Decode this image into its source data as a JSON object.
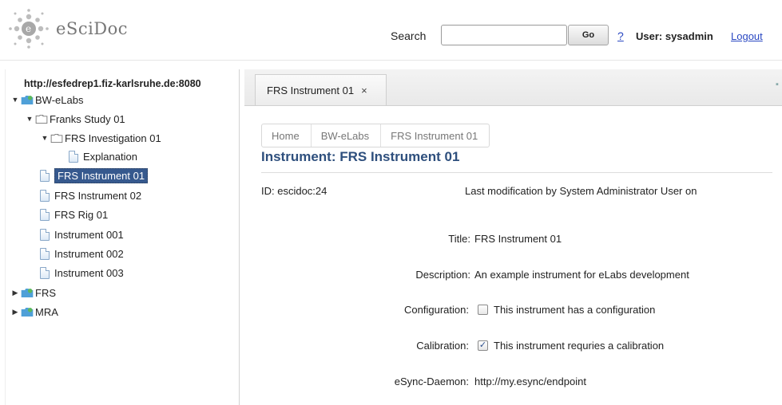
{
  "header": {
    "logo_text": "eSciDoc",
    "search_label": "Search",
    "search_value": "",
    "go_label": "Go",
    "help_label": "?",
    "user_label": "User: sysadmin",
    "logout_label": "Logout"
  },
  "tree": {
    "server": "http://esfedrep1.fiz-karlsruhe.de:8080",
    "items": [
      {
        "label": "BW-eLabs",
        "arrow": "▼",
        "icon": "context-folder-icon"
      },
      {
        "label": "Franks Study 01",
        "arrow": "▼",
        "icon": "folder-icon"
      },
      {
        "label": "FRS Investigation 01",
        "arrow": "▼",
        "icon": "folder-icon"
      },
      {
        "label": "Explanation",
        "arrow": "",
        "icon": "document-icon"
      },
      {
        "label": "FRS Instrument 01",
        "arrow": "",
        "icon": "document-icon"
      },
      {
        "label": "FRS Instrument 02",
        "arrow": "",
        "icon": "document-icon"
      },
      {
        "label": "FRS Rig 01",
        "arrow": "",
        "icon": "document-icon"
      },
      {
        "label": "Instrument 001",
        "arrow": "",
        "icon": "document-icon"
      },
      {
        "label": "Instrument 002",
        "arrow": "",
        "icon": "document-icon"
      },
      {
        "label": "Instrument 003",
        "arrow": "",
        "icon": "document-icon"
      },
      {
        "label": "FRS",
        "arrow": "▶",
        "icon": "context-folder-icon"
      },
      {
        "label": "MRA",
        "arrow": "▶",
        "icon": "context-folder-icon"
      }
    ],
    "selected": "FRS Instrument 01"
  },
  "tab": {
    "label": "FRS Instrument 01",
    "close": "×"
  },
  "breadcrumb": [
    "Home",
    "BW-eLabs",
    "FRS Instrument 01"
  ],
  "detail": {
    "title": "Instrument: FRS Instrument 01",
    "id": "ID: escidoc:24",
    "modified": "Last modification by System Administrator User on",
    "fields": {
      "title_label": "Title:",
      "title_value": "FRS Instrument 01",
      "description_label": "Description:",
      "description_value": "An example instrument for eLabs development",
      "configuration_label": "Configuration:",
      "configuration_value": "This instrument has a configuration",
      "configuration_checked": false,
      "calibration_label": "Calibration:",
      "calibration_value": "This instrument requries a calibration",
      "calibration_checked": true,
      "esync_label": "eSync-Daemon:",
      "esync_value": "http://my.esync/endpoint"
    }
  },
  "colors": {
    "title": "#2e4f7d",
    "selection": "#36598e",
    "link": "#2a48c2"
  }
}
